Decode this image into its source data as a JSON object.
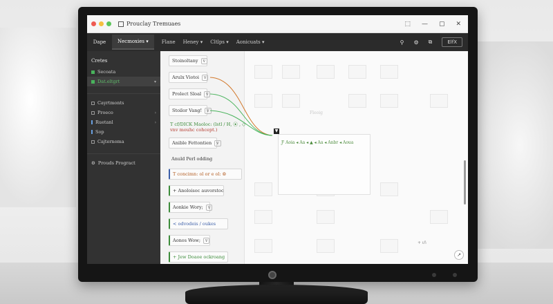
{
  "window": {
    "title": "Prouclay Tremuaes",
    "controls": [
      "⬚",
      "—",
      "▢",
      "✕"
    ]
  },
  "menubar": {
    "brand": "Dape",
    "active": "Necmoxies",
    "items": [
      "Flane",
      "Heney",
      "Cltlps",
      "Aonicuats"
    ],
    "right_icons": [
      "⚲",
      "⚙",
      "⧉"
    ],
    "right_box": "ElfX"
  },
  "sidebar": {
    "header": "Cretes",
    "group1": [
      {
        "label": "Secoata",
        "icon": "green-square"
      },
      {
        "label": "Dat.eltgrt",
        "selected": true
      }
    ],
    "group2": [
      {
        "label": "Cayrtmonts"
      },
      {
        "label": "Proeco"
      },
      {
        "label": "Ruetanl"
      },
      {
        "label": "Sop"
      },
      {
        "label": "Cajternoma"
      }
    ],
    "footer": "Prouds Progract"
  },
  "nodes": [
    {
      "label": "Stoinoltany",
      "pill": "v",
      "row": 0
    },
    {
      "label": "Arulx Viotoi",
      "pill": "v",
      "row": 1
    },
    {
      "label": "Prolect Sloal",
      "pill": "v",
      "row": 2
    },
    {
      "label": "Stoilor Vang!",
      "pill": "v",
      "row": 3
    }
  ],
  "node_text": {
    "green_line": "T cf/DICK Maoloc: (lstl / H, ⦿ , ◇",
    "red_line": "vnv mouhc cohcept.)"
  },
  "nodes_lower": [
    {
      "label": "Anible Fettontien",
      "pill": "v"
    },
    {
      "label": "Anuld Perl odding"
    },
    {
      "label": "T concimn: ol or e ol: ⦾"
    },
    {
      "label": "+ Anoloisoc auvorstoc"
    },
    {
      "label": "Aonkie Wory;",
      "pill": "v"
    },
    {
      "label": "< odvodeis / oukes"
    },
    {
      "label": "Aonos Wow;",
      "pill": "v"
    },
    {
      "label": "+ Jew Doaoe ockroang"
    }
  ],
  "preview": {
    "marker": "▼",
    "row": "Ƒ Aoia ◂ Aa ◂ ▲ ◂ Aa ◂ Anbr ◂ Aoua"
  },
  "ghost_label": "Fleoig",
  "canvas_controls": "+ ɩn̈",
  "fab": "↗",
  "colors": {
    "accent_green": "#49b35c",
    "accent_orange": "#d2772a",
    "accent_red": "#c0392b",
    "sidebar_bg": "#323232",
    "menubar_bg": "#2b2b2b"
  }
}
